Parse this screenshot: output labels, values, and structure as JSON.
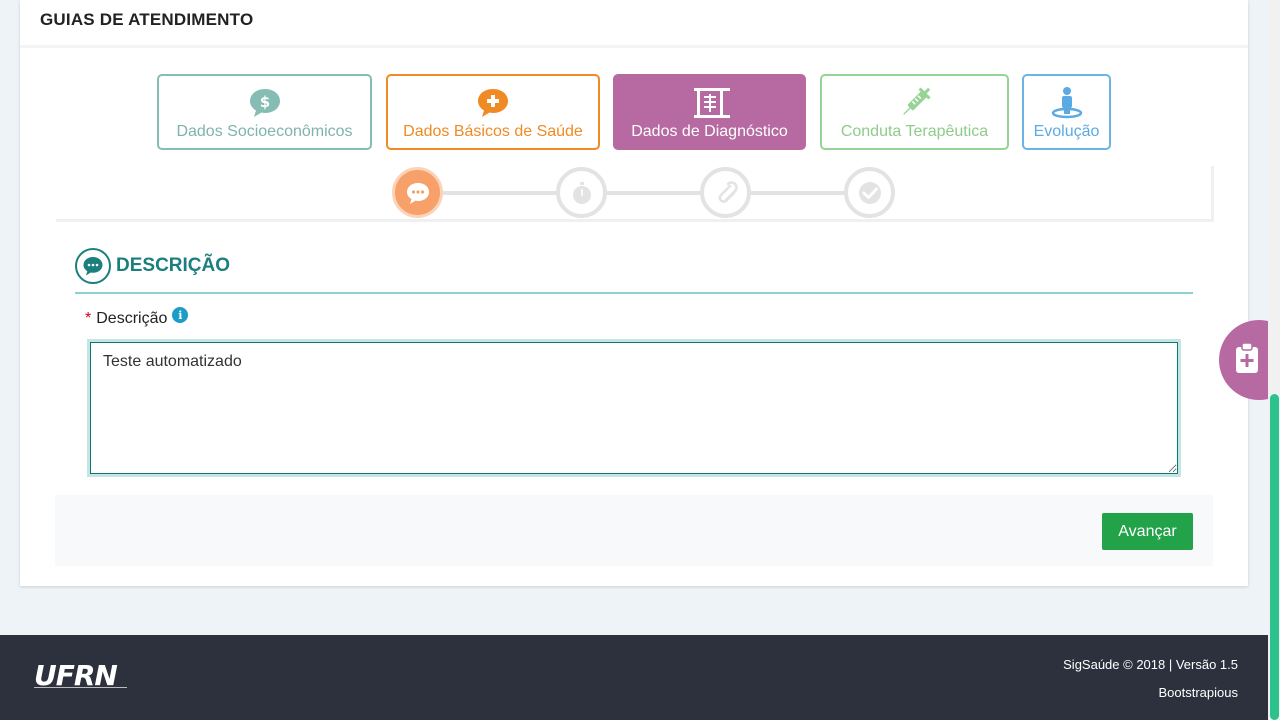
{
  "header": {
    "title": "GUIAS DE ATENDIMENTO"
  },
  "tabs": [
    {
      "label": "Dados Socioeconômicos",
      "icon": "dollar-chat-icon"
    },
    {
      "label": "Dados Básicos de Saúde",
      "icon": "plus-chat-icon"
    },
    {
      "label": "Dados de Diagnóstico",
      "icon": "projector-screen-icon"
    },
    {
      "label": "Conduta Terapêutica",
      "icon": "syringe-icon"
    },
    {
      "label": "Evolução",
      "icon": "person-icon"
    }
  ],
  "active_tab": "Dados de Diagnóstico",
  "steps": [
    {
      "icon": "comment-icon",
      "state": "active"
    },
    {
      "icon": "stopwatch-icon",
      "state": "inactive"
    },
    {
      "icon": "paperclip-icon",
      "state": "inactive"
    },
    {
      "icon": "check-icon",
      "state": "inactive"
    }
  ],
  "section": {
    "title": "DESCRIÇÃO",
    "icon": "comment-icon"
  },
  "form": {
    "required_mark": "*",
    "description_label": "Descrição",
    "info_glyph": "i",
    "description_value": "Teste automatizado"
  },
  "actions": {
    "next_label": "Avançar"
  },
  "footer": {
    "logo": "UFRN",
    "copyright": "SigSaúde © 2018 | Versão 1.5",
    "credit": "Bootstrapious"
  },
  "colors": {
    "accent_purple": "#b76aa1",
    "accent_orange": "#f08a24",
    "accent_teal": "#1b7f7d",
    "success_green": "#22a249"
  }
}
